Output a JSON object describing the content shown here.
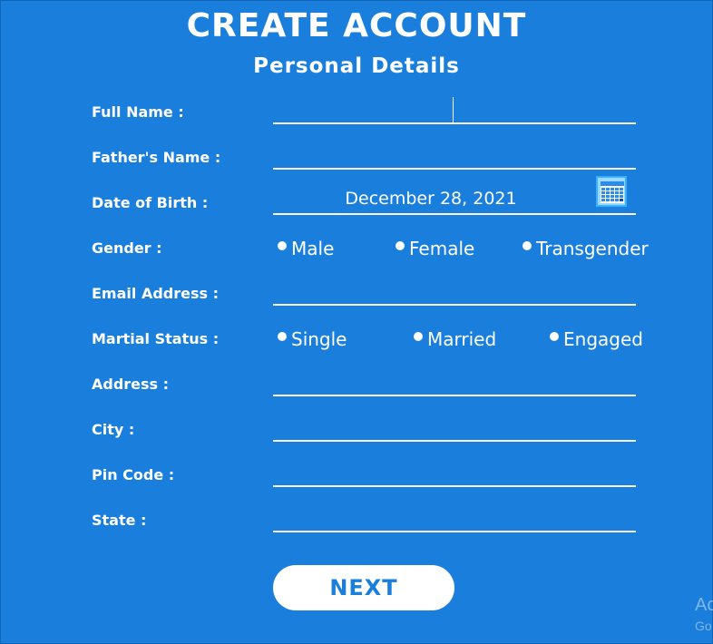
{
  "header": {
    "title": "CREATE ACCOUNT",
    "subtitle": "Personal Details"
  },
  "form": {
    "full_name": {
      "label": "Full Name :",
      "value": ""
    },
    "father_name": {
      "label": "Father's Name :",
      "value": ""
    },
    "dob": {
      "label": "Date of Birth :",
      "value": "December 28, 2021",
      "icon": "calendar-icon"
    },
    "gender": {
      "label": "Gender :",
      "options": [
        "Male",
        "Female",
        "Transgender"
      ]
    },
    "email": {
      "label": "Email Address :",
      "value": ""
    },
    "marital_status": {
      "label": "Martial Status :",
      "options": [
        "Single",
        "Married",
        "Engaged"
      ]
    },
    "address": {
      "label": "Address :",
      "value": ""
    },
    "city": {
      "label": "City :",
      "value": ""
    },
    "pin_code": {
      "label": "Pin Code :",
      "value": ""
    },
    "state": {
      "label": "State :",
      "value": ""
    }
  },
  "actions": {
    "next_label": "NEXT"
  },
  "watermark": {
    "line1": "Ac",
    "line2": "Go"
  },
  "colors": {
    "background": "#1a7edd",
    "text": "#ffffff",
    "button_text": "#1a7edd"
  }
}
